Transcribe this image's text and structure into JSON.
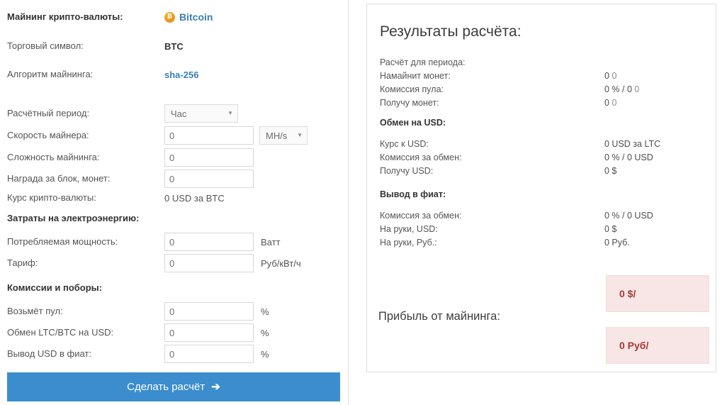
{
  "left": {
    "currency_row": {
      "label": "Майнинг крипто-валюты:",
      "coin_icon": "bitcoin-coin-icon",
      "coin_glyph": "Ƀ",
      "coin_name": "Bitcoin"
    },
    "ticker_row": {
      "label": "Торговый символ:",
      "value": "BTC"
    },
    "algo_row": {
      "label": "Алгоритм майнинга:",
      "value": "sha-256"
    },
    "period_row": {
      "label": "Расчётный период:",
      "selected": "Час"
    },
    "hashrate_row": {
      "label": "Скорость майнера:",
      "value": "0",
      "unit_selected": "MH/s"
    },
    "difficulty_row": {
      "label": "Сложность майнинга:",
      "value": "0"
    },
    "blockreward_row": {
      "label": "Награда за блок, монет:",
      "value": "0"
    },
    "price_row": {
      "label": "Курс крипто-валюты:",
      "value": "0 USD за BTC"
    },
    "power_section": {
      "title": "Затраты на электроэнергию:"
    },
    "power_row": {
      "label": "Потребляемая мощность:",
      "value": "0",
      "suffix": "Ватт"
    },
    "tariff_row": {
      "label": "Тариф:",
      "value": "0",
      "suffix": "Руб/кВт/ч"
    },
    "fees_section": {
      "title": "Комиссии и поборы:"
    },
    "pool_fee_row": {
      "label": "Возьмёт пул:",
      "value": "0",
      "suffix": "%"
    },
    "exchange_fee_row": {
      "label": "Обмен LTC/BTC на USD:",
      "value": "0",
      "suffix": "%"
    },
    "withdraw_fee_row": {
      "label": "Вывод USD в фиат:",
      "value": "0",
      "suffix": "%"
    },
    "calc_button": {
      "label": "Сделать расчёт",
      "arrow": "➔"
    }
  },
  "results": {
    "title": "Результаты расчёта:",
    "period_row": {
      "label": "Расчёт для периода:",
      "value": ""
    },
    "mined_row": {
      "label": "Намайнит монет:",
      "value": "0",
      "value_dim": "0"
    },
    "pool_fee_row": {
      "label": "Комиссия пула:",
      "value": "0 % / 0",
      "value_dim": "0"
    },
    "receive_coins_row": {
      "label": "Получу монет:",
      "value": "0",
      "value_dim": "0"
    },
    "usd_section": {
      "title": "Обмен на USD:"
    },
    "usd_rate_row": {
      "label": "Курс к USD:",
      "value": "0 USD за LTC"
    },
    "usd_fee_row": {
      "label": "Комиссия за обмен:",
      "value": "0 % / 0 USD"
    },
    "usd_receive_row": {
      "label": "Получу USD:",
      "value": "0 $"
    },
    "fiat_section": {
      "title": "Вывод в фиат:"
    },
    "fiat_fee_row": {
      "label": "Комиссия за обмен:",
      "value": "0 % / 0 USD"
    },
    "fiat_usd_row": {
      "label": "На руки, USD:",
      "value": "0 $"
    },
    "fiat_rub_row": {
      "label": "На руки, Руб.:",
      "value": "0 Руб."
    },
    "profit_label": "Прибыль от майнинга:",
    "profit_usd": "0 $/",
    "profit_rub": "0 Руб/"
  },
  "colors": {
    "accent_button": "#3b8dcd",
    "link": "#3a7fb5",
    "coin_orange": "#e8921c",
    "profit_box_bg": "#f8e5e5",
    "profit_text": "#a43a34"
  }
}
